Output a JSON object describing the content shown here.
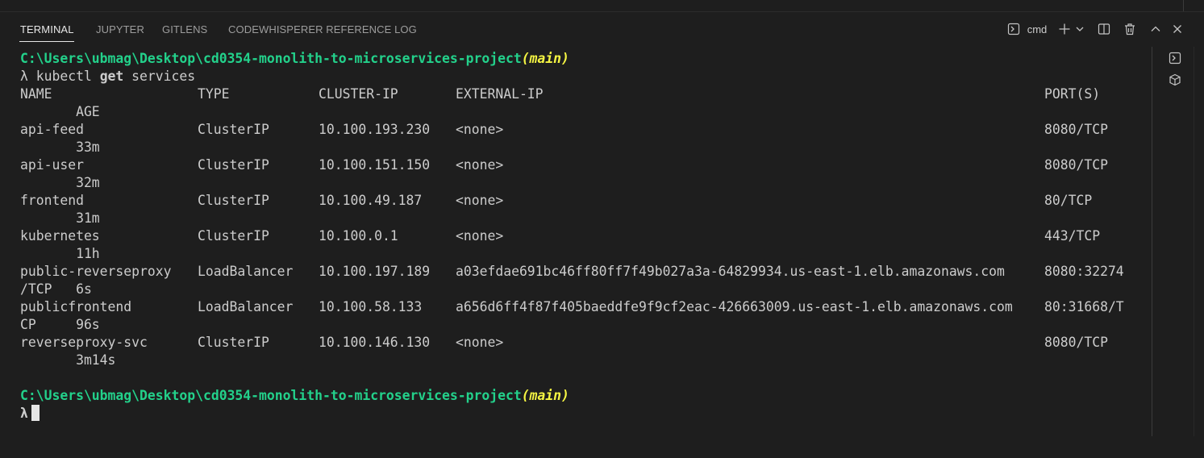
{
  "tabs": [
    {
      "label": "TERMINAL",
      "active": true
    },
    {
      "label": "JUPYTER",
      "active": false
    },
    {
      "label": "GITLENS",
      "active": false
    },
    {
      "label": "CODEWHISPERER REFERENCE LOG",
      "active": false
    }
  ],
  "toolbar": {
    "shell_label": "cmd",
    "icons": [
      "terminal-icon",
      "plus-icon",
      "chevron-down-icon",
      "split-icon",
      "trash-icon",
      "chevron-up-icon",
      "close-icon"
    ]
  },
  "terminal": {
    "prompt_path": "C:\\Users\\ubmag\\Desktop\\cd0354-monolith-to-microservices-project",
    "prompt_branch": "(main)",
    "lambda": "λ",
    "command_pre": " kubectl ",
    "command_bold": "get",
    "command_post": " services",
    "header": {
      "name": "NAME",
      "type": "TYPE",
      "cluster_ip": "CLUSTER-IP",
      "external_ip": "EXTERNAL-IP",
      "ports": "PORT(S)",
      "age": "       AGE"
    },
    "rows": [
      {
        "name": "api-feed",
        "type": "ClusterIP",
        "cluster_ip": "10.100.193.230",
        "external_ip": "<none>",
        "ports": "8080/TCP",
        "wrap": "       33m"
      },
      {
        "name": "api-user",
        "type": "ClusterIP",
        "cluster_ip": "10.100.151.150",
        "external_ip": "<none>",
        "ports": "8080/TCP",
        "wrap": "       32m"
      },
      {
        "name": "frontend",
        "type": "ClusterIP",
        "cluster_ip": "10.100.49.187",
        "external_ip": "<none>",
        "ports": "80/TCP",
        "wrap": "       31m"
      },
      {
        "name": "kubernetes",
        "type": "ClusterIP",
        "cluster_ip": "10.100.0.1",
        "external_ip": "<none>",
        "ports": "443/TCP",
        "wrap": "       11h"
      },
      {
        "name": "public-reverseproxy",
        "type": "LoadBalancer",
        "cluster_ip": "10.100.197.189",
        "external_ip": "a03efdae691bc46ff80ff7f49b027a3a-64829934.us-east-1.elb.amazonaws.com",
        "ports": "8080:32274",
        "wrap": "/TCP   6s"
      },
      {
        "name": "publicfrontend",
        "type": "LoadBalancer",
        "cluster_ip": "10.100.58.133",
        "external_ip": "a656d6ff4f87f405baeddfe9f9cf2eac-426663009.us-east-1.elb.amazonaws.com",
        "ports": "80:31668/T",
        "wrap": "CP     96s"
      },
      {
        "name": "reverseproxy-svc",
        "type": "ClusterIP",
        "cluster_ip": "10.100.146.130",
        "external_ip": "<none>",
        "ports": "8080/TCP",
        "wrap": "       3m14s"
      }
    ]
  },
  "right_rail": {
    "icons": [
      "terminal-icon",
      "package-icon"
    ]
  }
}
